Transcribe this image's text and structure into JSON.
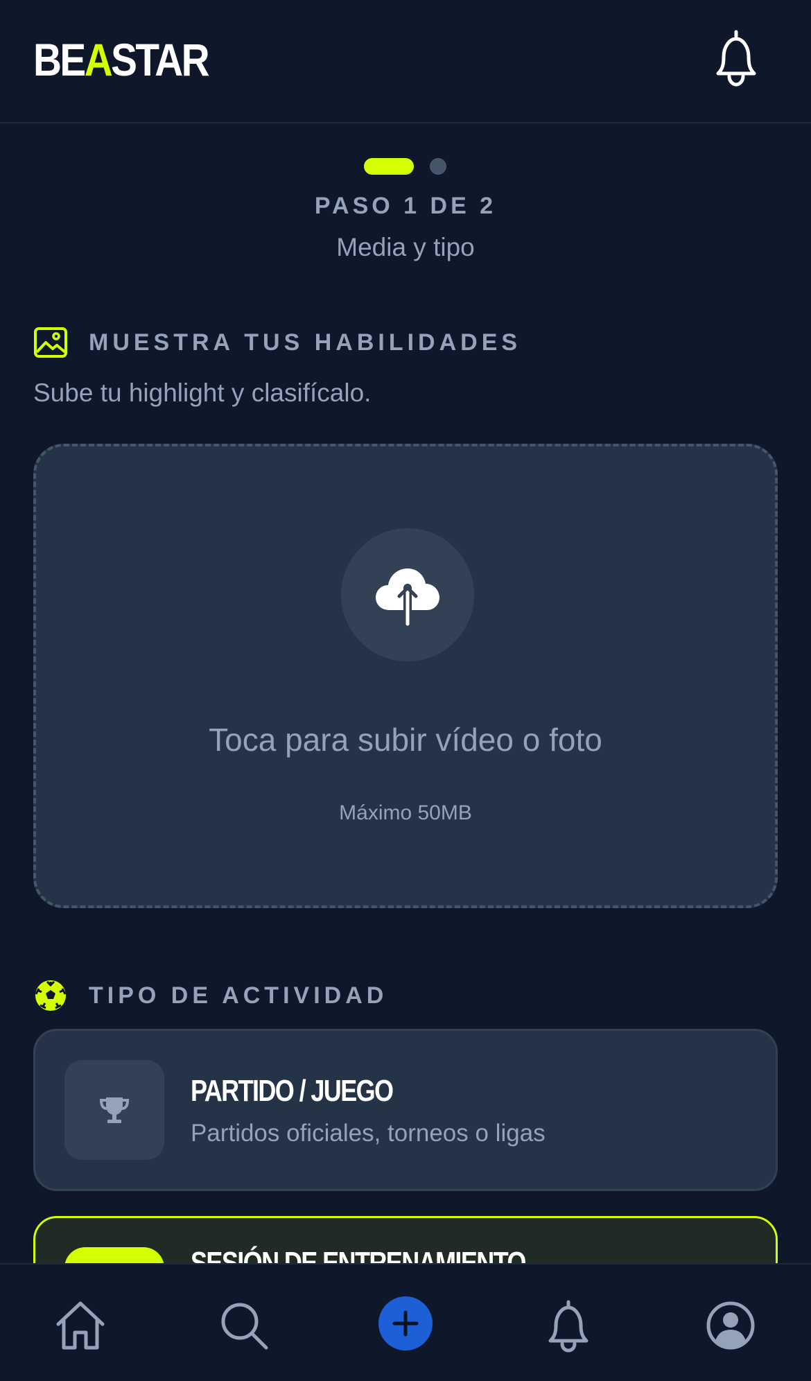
{
  "app": {
    "logo_prefix": "BE",
    "logo_accent": "A",
    "logo_suffix": "STAR",
    "accent_color": "#d4ff00",
    "background_color": "#0f172a"
  },
  "header": {
    "notifications_icon": "bell-icon"
  },
  "stepper": {
    "current_step": 1,
    "total_steps": 2,
    "label": "PASO 1 DE 2",
    "subtitle": "Media y tipo"
  },
  "skills_section": {
    "icon": "image-icon",
    "title": "MUESTRA TUS HABILIDADES",
    "description": "Sube tu highlight y clasifícalo."
  },
  "upload": {
    "icon": "cloud-upload-icon",
    "prompt": "Toca para subir vídeo o foto",
    "limit": "Máximo 50MB"
  },
  "activity_section": {
    "icon": "soccer-ball-icon",
    "title": "TIPO DE ACTIVIDAD",
    "options": [
      {
        "icon": "trophy-icon",
        "title": "PARTIDO / JUEGO",
        "description": "Partidos oficiales, torneos o ligas",
        "selected": false
      },
      {
        "title": "SESIÓN DE ENTRENAMIENTO",
        "selected": true
      }
    ]
  },
  "bottom_nav": {
    "items": [
      "home-icon",
      "search-icon",
      "plus-icon",
      "bell-icon",
      "profile-icon"
    ],
    "create_color": "#1d5fd6"
  }
}
